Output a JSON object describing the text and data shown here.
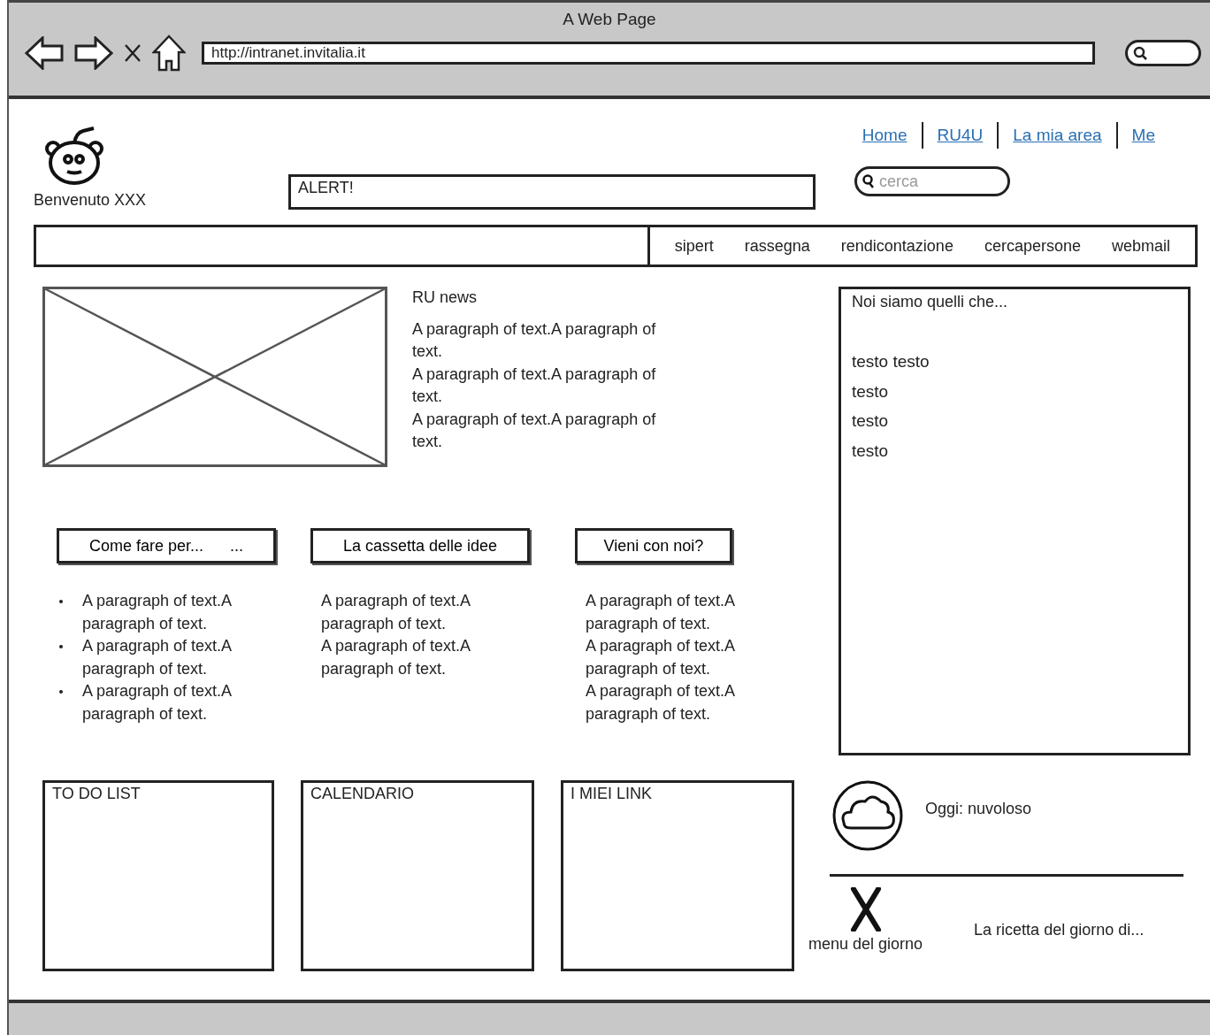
{
  "window": {
    "title": "A Web Page"
  },
  "browser": {
    "url": "http://intranet.invitalia.it"
  },
  "header": {
    "welcome": "Benvenuto XXX",
    "alert": "ALERT!",
    "links": [
      "Home",
      "RU4U",
      "La mia area",
      "Me"
    ],
    "search": {
      "placeholder": "cerca"
    }
  },
  "nav": [
    "sipert",
    "rassegna",
    "rendicontazione",
    "cercapersone",
    "webmail"
  ],
  "news": {
    "title": "RU news",
    "paragraphs": [
      "A paragraph of text.A paragraph of text.",
      "A paragraph of text.A paragraph of text.",
      "A paragraph of text.A paragraph of text."
    ]
  },
  "sections": [
    {
      "button": "Come fare per...      ...",
      "kind": "bulleted",
      "paragraphs": [
        "A paragraph of text.A paragraph of text.",
        "A paragraph of text.A paragraph of text.",
        "A paragraph of text.A paragraph of text."
      ]
    },
    {
      "button": "La cassetta delle idee",
      "kind": "plain",
      "paragraphs": [
        "A paragraph of text.A paragraph of text.",
        "A paragraph of text.A paragraph of text."
      ]
    },
    {
      "button": "Vieni con noi?",
      "kind": "plain",
      "paragraphs": [
        "A paragraph of text.A paragraph of text.",
        "A paragraph of text.A paragraph of text.",
        "A paragraph of text.A paragraph of text."
      ]
    }
  ],
  "widgets": [
    {
      "title": "TO DO LIST"
    },
    {
      "title": "CALENDARIO"
    },
    {
      "title": "I MIEI LINK"
    }
  ],
  "side_panel": {
    "title": "Noi siamo quelli che...",
    "items": [
      "testo testo",
      "testo",
      "testo",
      "testo"
    ]
  },
  "weather": {
    "text": "Oggi: nuvoloso"
  },
  "menu": {
    "label": "menu del giorno",
    "text": "La ricetta del giorno di..."
  }
}
